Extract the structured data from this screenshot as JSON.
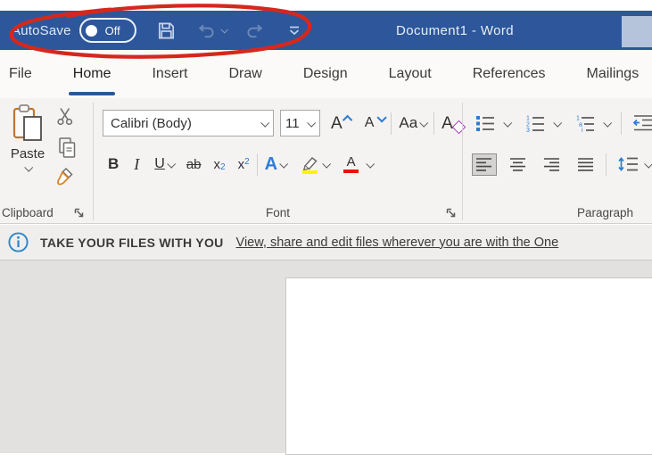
{
  "titlebar": {
    "autosave_label": "AutoSave",
    "autosave_state": "Off",
    "title": "Document1 - Word"
  },
  "tabs": {
    "items": [
      {
        "label": "File",
        "active": false
      },
      {
        "label": "Home",
        "active": true
      },
      {
        "label": "Insert",
        "active": false
      },
      {
        "label": "Draw",
        "active": false
      },
      {
        "label": "Design",
        "active": false
      },
      {
        "label": "Layout",
        "active": false
      },
      {
        "label": "References",
        "active": false
      },
      {
        "label": "Mailings",
        "active": false
      }
    ]
  },
  "ribbon": {
    "clipboard": {
      "label": "Clipboard",
      "paste": "Paste"
    },
    "font": {
      "label": "Font",
      "family": "Calibri (Body)",
      "size": "11",
      "grow": "A",
      "shrink": "A",
      "change_case": "Aa",
      "clear": "A",
      "bold": "B",
      "italic": "I",
      "underline": "U",
      "strikethrough": "ab",
      "sub_base": "x",
      "sub_mark": "2",
      "sup_base": "x",
      "sup_mark": "2",
      "effects": "A",
      "font_color": "A"
    },
    "paragraph": {
      "label": "Paragraph"
    }
  },
  "notification": {
    "headline": "TAKE YOUR FILES WITH YOU",
    "link": "View, share and edit files wherever you are with the One"
  },
  "icons": {
    "titlebar": [
      "save-icon",
      "undo-icon",
      "redo-icon",
      "customize-quick-access-icon"
    ],
    "clipboard": [
      "paste-clipboard-icon",
      "cut-icon",
      "copy-icon",
      "format-painter-icon"
    ],
    "font": [
      "grow-font-icon",
      "shrink-font-icon",
      "change-case-icon",
      "clear-formatting-icon",
      "text-effects-icon",
      "highlight-icon",
      "font-color-icon"
    ],
    "paragraph": [
      "bullets-icon",
      "numbering-icon",
      "multilevel-list-icon",
      "decrease-indent-icon",
      "align-left-icon",
      "align-center-icon",
      "align-right-icon",
      "justify-icon",
      "line-spacing-icon"
    ],
    "notification": "info-icon",
    "annotation": "red-ellipse-annotation"
  },
  "colors": {
    "titlebar_blue": "#2d579a",
    "tab_underline": "#2b579a",
    "accent_blue": "#2b7cd3",
    "highlight_yellow": "#fff400",
    "font_color_red": "#eb1010",
    "annotation_red": "#d5281d"
  }
}
